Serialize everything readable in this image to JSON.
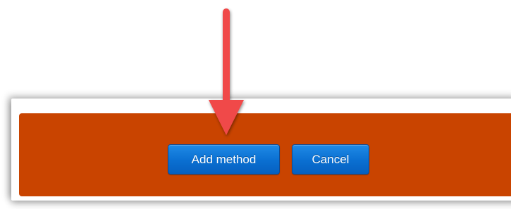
{
  "actions": {
    "add_method_label": "Add method",
    "cancel_label": "Cancel"
  },
  "colors": {
    "action_bar": "#c94400",
    "button": "#0a6fd1",
    "arrow": "#f04848"
  },
  "annotation": {
    "icon": "down-arrow-icon"
  }
}
